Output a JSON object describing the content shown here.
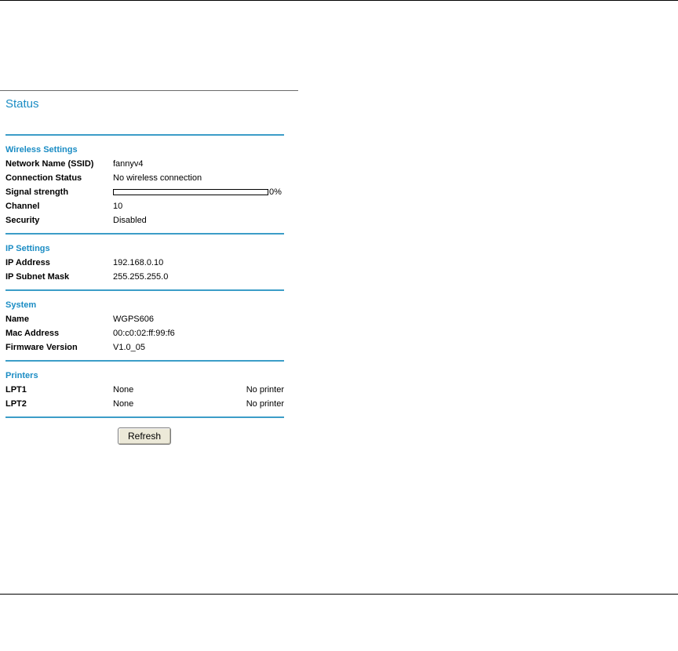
{
  "page": {
    "title": "Status"
  },
  "wireless": {
    "heading": "Wireless Settings",
    "ssid": {
      "label": "Network Name (SSID)",
      "value": "fannyv4"
    },
    "connection": {
      "label": "Connection Status",
      "value": "No wireless connection"
    },
    "signal": {
      "label": "Signal strength",
      "value_text": "0%",
      "percent": 0
    },
    "channel": {
      "label": "Channel",
      "value": "10"
    },
    "security": {
      "label": "Security",
      "value": "Disabled"
    }
  },
  "ip": {
    "heading": "IP Settings",
    "address": {
      "label": "IP Address",
      "value": "192.168.0.10"
    },
    "mask": {
      "label": "IP Subnet Mask",
      "value": "255.255.255.0"
    }
  },
  "system": {
    "heading": "System",
    "name": {
      "label": "Name",
      "value": "WGPS606"
    },
    "mac": {
      "label": "Mac Address",
      "value": "00:c0:02:ff:99:f6"
    },
    "firmware": {
      "label": "Firmware Version",
      "value": "V1.0_05"
    }
  },
  "printers": {
    "heading": "Printers",
    "items": [
      {
        "label": "LPT1",
        "value": "None",
        "status": "No printer"
      },
      {
        "label": "LPT2",
        "value": "None",
        "status": "No printer"
      }
    ]
  },
  "actions": {
    "refresh_label": "Refresh"
  },
  "colors": {
    "accent": "#1a8cc4",
    "rule": "#3c9dc8"
  }
}
